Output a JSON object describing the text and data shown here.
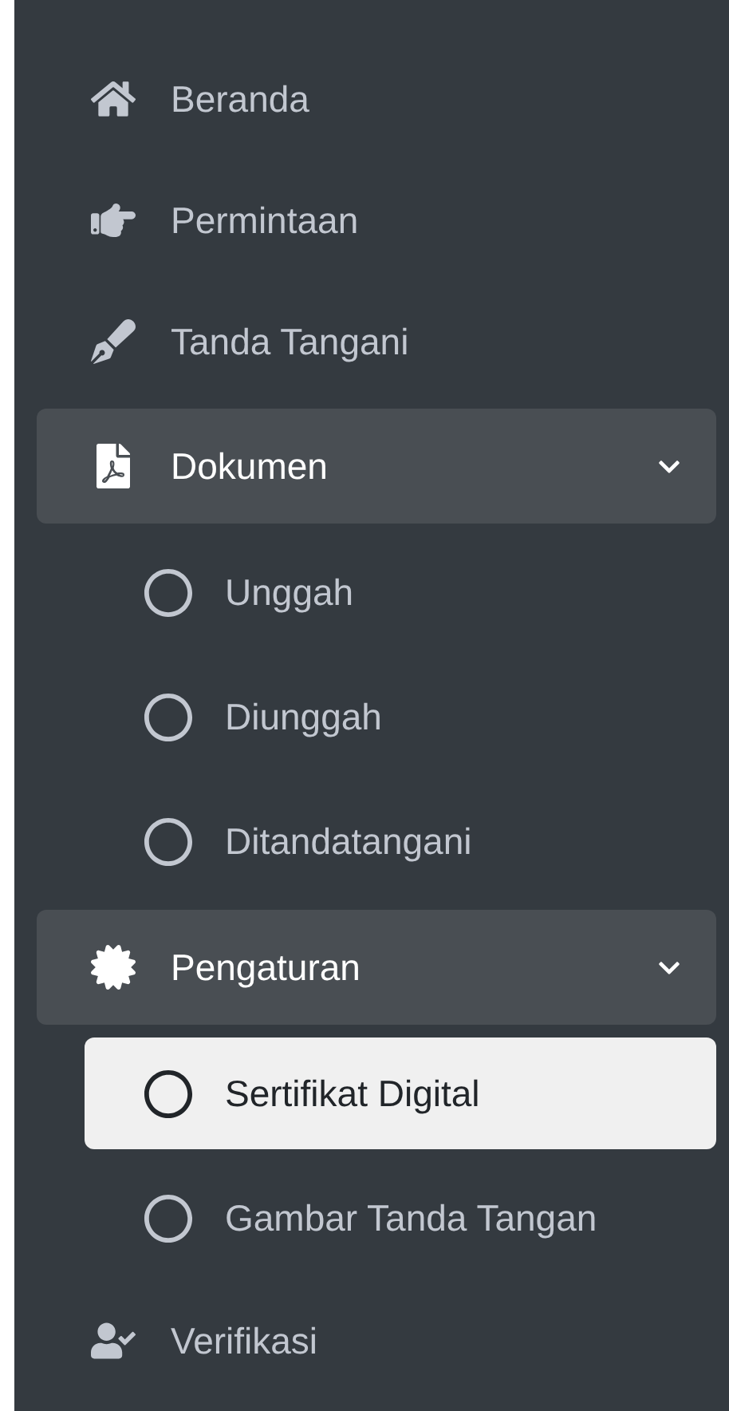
{
  "sidebar": {
    "items": [
      {
        "label": "Beranda",
        "selected": false
      },
      {
        "label": "Permintaan",
        "selected": false
      },
      {
        "label": "Tanda Tangani",
        "selected": false
      },
      {
        "label": "Dokumen",
        "selected": false,
        "expanded": true,
        "children": [
          {
            "label": "Unggah",
            "selected": false
          },
          {
            "label": "Diunggah",
            "selected": false
          },
          {
            "label": "Ditandatangani",
            "selected": false
          }
        ]
      },
      {
        "label": "Pengaturan",
        "selected": false,
        "expanded": true,
        "children": [
          {
            "label": "Sertifikat Digital",
            "selected": true
          },
          {
            "label": "Gambar Tanda Tangan",
            "selected": false
          }
        ]
      },
      {
        "label": "Verifikasi",
        "selected": false
      }
    ]
  }
}
